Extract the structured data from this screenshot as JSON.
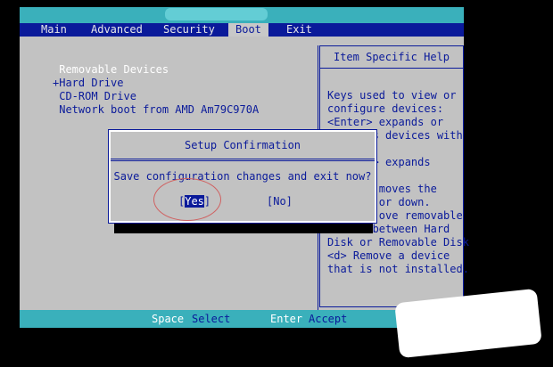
{
  "menubar": {
    "tabs": [
      {
        "label": "Main",
        "active": false
      },
      {
        "label": "Advanced",
        "active": false
      },
      {
        "label": "Security",
        "active": false
      },
      {
        "label": "Boot",
        "active": true
      },
      {
        "label": "Exit",
        "active": false
      }
    ]
  },
  "boot_list": {
    "items": [
      {
        "label": " Removable Devices",
        "selected": true
      },
      {
        "label": "+Hard Drive",
        "selected": false
      },
      {
        "label": " CD-ROM Drive",
        "selected": false
      },
      {
        "label": " Network boot from AMD Am79C970A",
        "selected": false
      }
    ]
  },
  "help": {
    "title": "Item Specific Help",
    "lines": [
      "Keys used to view or",
      "configure devices:",
      "<Enter> expands or",
      "       s devices with",
      "",
      "     er> expands",
      "",
      "     -> moves the",
      "        or down.",
      "        ove removable",
      "device between Hard",
      "Disk or Removable Disk",
      "<d> Remove a device",
      "that is not installed."
    ]
  },
  "dialog": {
    "title": "Setup Confirmation",
    "message": "Save configuration changes and exit now?",
    "yes_prefix": "[",
    "yes_label": "Yes",
    "yes_suffix": "]",
    "no_label": "[No]"
  },
  "statusbar": {
    "items": [
      {
        "key": "Space",
        "desc": "Select"
      },
      {
        "key": "Enter",
        "desc": "Accept"
      }
    ]
  },
  "colors": {
    "bios_blue": "#0a1a9a",
    "bios_gray": "#c2c2c2",
    "bios_cyan": "#3ab0bb"
  }
}
